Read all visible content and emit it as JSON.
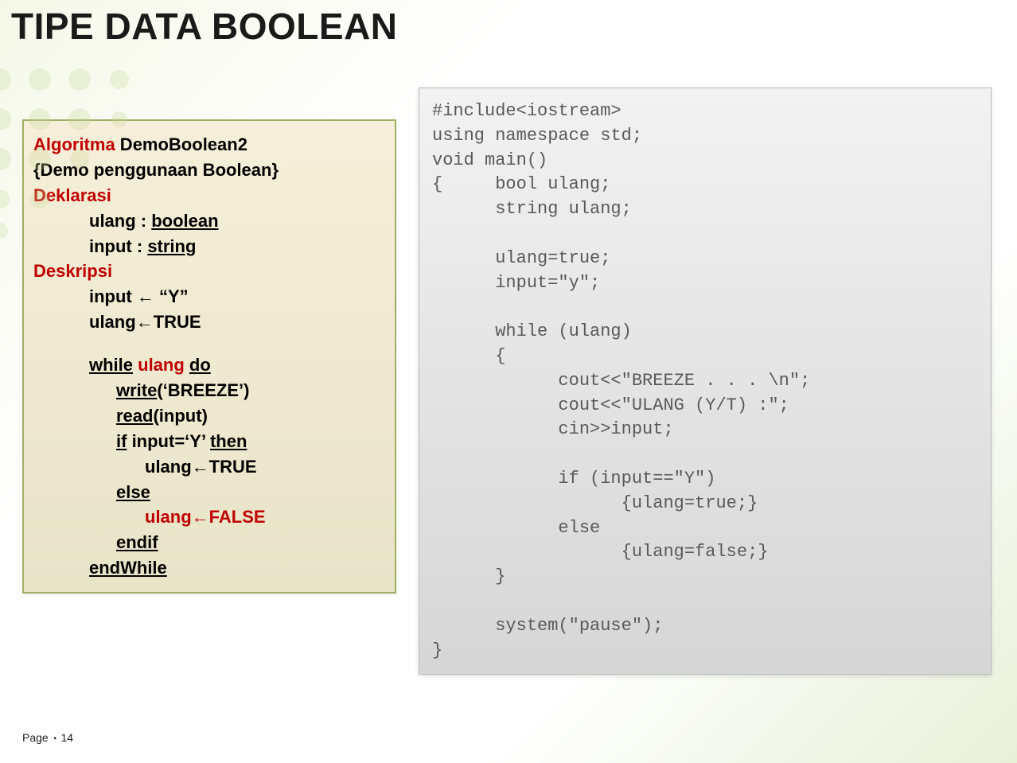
{
  "title": "TIPE DATA BOOLEAN",
  "algo": {
    "l1_a": "Algoritma",
    "l1_b": " DemoBoolean2",
    "l2": "{Demo penggunaan Boolean}",
    "l3": "Deklarasi",
    "l4_a": "ulang : ",
    "l4_b": "boolean",
    "l5_a": "input  : ",
    "l5_b": "string",
    "l6": "Deskripsi",
    "l7": "input  ←  “Y”",
    "l8": "ulang←TRUE",
    "l9_a": "while",
    "l9_b": " ulang ",
    "l9_c": "do",
    "l10_a": "write",
    "l10_b": "(‘BREEZE’)",
    "l11_a": "read",
    "l11_b": "(input)",
    "l12_a": "if",
    "l12_b": " input=‘Y’ ",
    "l12_c": "then",
    "l13": "ulang←TRUE",
    "l14": "else",
    "l15": "ulang←FALSE",
    "l16": "endif",
    "l17": "endWhile"
  },
  "code": "#include<iostream>\nusing namespace std;\nvoid main()\n{     bool ulang;\n      string ulang;\n\n      ulang=true;\n      input=\"y\";\n\n      while (ulang)\n      {\n            cout<<\"BREEZE . . . \\n\";\n            cout<<\"ULANG (Y/T) :\";\n            cin>>input;\n\n            if (input==\"Y\")\n                  {ulang=true;}\n            else\n                  {ulang=false;}\n      }\n\n      system(\"pause\");\n}",
  "footer_page": "Page",
  "footer_num": "14"
}
